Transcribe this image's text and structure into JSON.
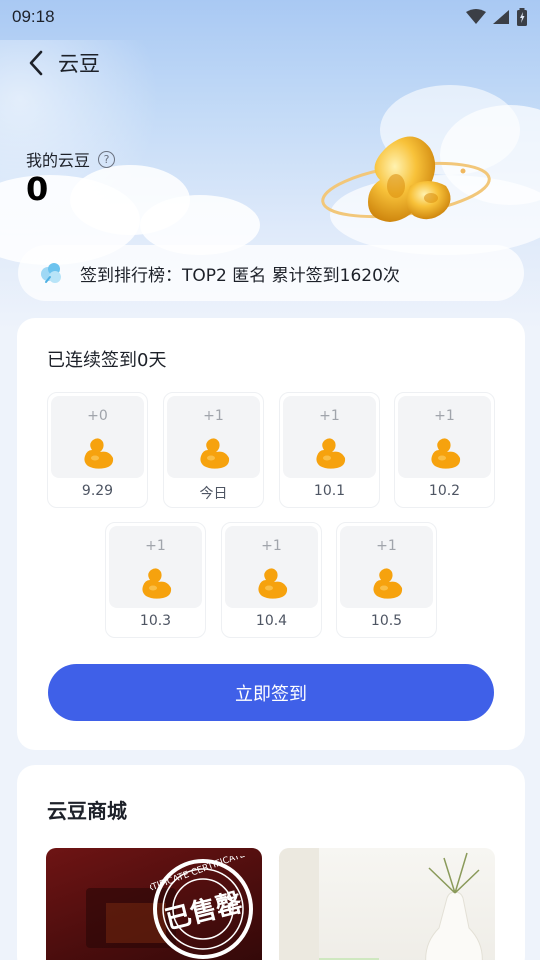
{
  "status_bar": {
    "time": "09:18"
  },
  "nav": {
    "title": "云豆"
  },
  "balance": {
    "label": "我的云豆",
    "value": "0"
  },
  "rank": {
    "text": "签到排行榜：TOP2 匿名 累计签到1620次"
  },
  "checkin": {
    "streak_text": "已连续签到0天",
    "days": [
      {
        "points": "+0",
        "date": "9.29"
      },
      {
        "points": "+1",
        "date": "今日"
      },
      {
        "points": "+1",
        "date": "10.1"
      },
      {
        "points": "+1",
        "date": "10.2"
      },
      {
        "points": "+1",
        "date": "10.3"
      },
      {
        "points": "+1",
        "date": "10.4"
      },
      {
        "points": "+1",
        "date": "10.5"
      }
    ],
    "button_label": "立即签到"
  },
  "mall": {
    "title": "云豆商城",
    "products": [
      {
        "stamp": "已售罄",
        "stamp_ring": "CERTIFICATE CERTIFICATE"
      },
      {
        "stamp": ""
      }
    ]
  },
  "colors": {
    "accent": "#3f60e8",
    "bean": "#f6a20e"
  },
  "icons": [
    "back-arrow-icon",
    "help-icon",
    "cloud-bean-icon",
    "bean-icon",
    "wifi-icon",
    "signal-icon",
    "battery-icon"
  ]
}
